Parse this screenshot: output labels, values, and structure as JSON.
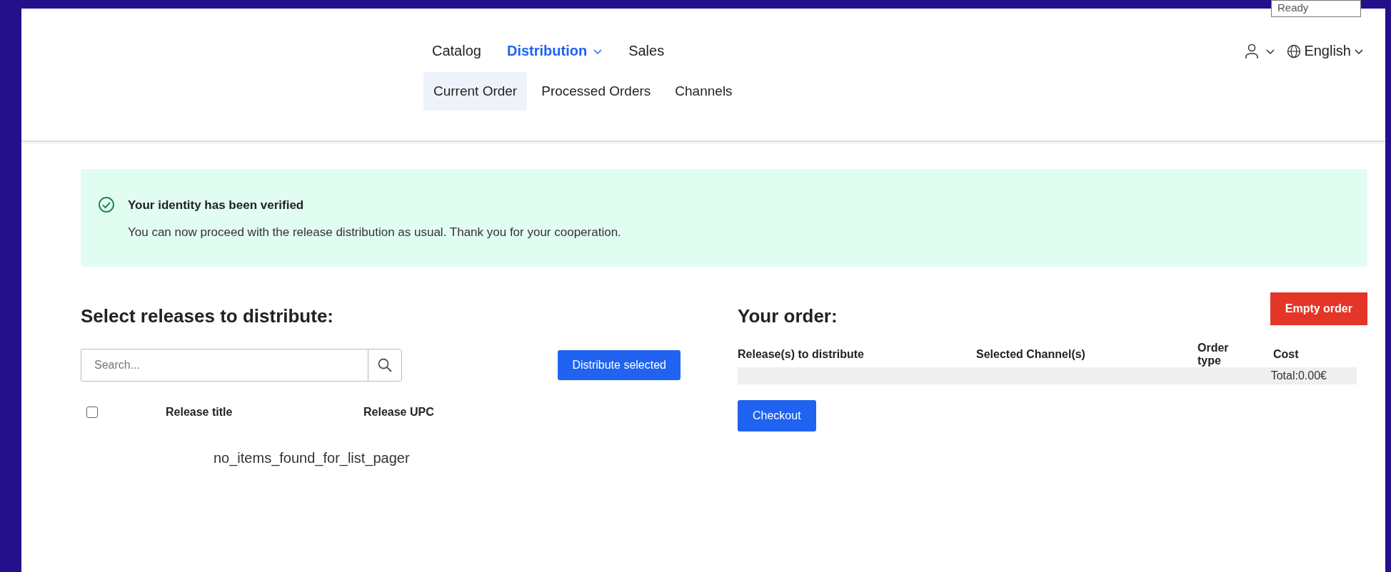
{
  "status_tooltip": "Ready",
  "nav": {
    "main": [
      {
        "label": "Catalog",
        "selected": false,
        "has_menu": false
      },
      {
        "label": "Distribution",
        "selected": true,
        "has_menu": true
      },
      {
        "label": "Sales",
        "selected": false,
        "has_menu": false
      }
    ],
    "sub": [
      {
        "label": "Current Order",
        "selected": true
      },
      {
        "label": "Processed Orders",
        "selected": false
      },
      {
        "label": "Channels",
        "selected": false
      }
    ]
  },
  "language": "English",
  "alert": {
    "title": "Your identity has been verified",
    "message": "You can now proceed with the release distribution as usual. Thank you for your cooperation."
  },
  "releases": {
    "heading": "Select releases to distribute:",
    "search": {
      "placeholder": "Search..."
    },
    "button": "Distribute selected",
    "select_all_checked": false,
    "columns": [
      "Release title",
      "Release UPC"
    ],
    "empty_text": "no_items_found_for_list_pager"
  },
  "order": {
    "heading": "Your order:",
    "empty_button": "Empty order",
    "columns": [
      "Release(s) to distribute",
      "Selected Channel(s)",
      "Order type",
      "Cost"
    ],
    "total": "Total:0.00€",
    "checkout": "Checkout"
  }
}
